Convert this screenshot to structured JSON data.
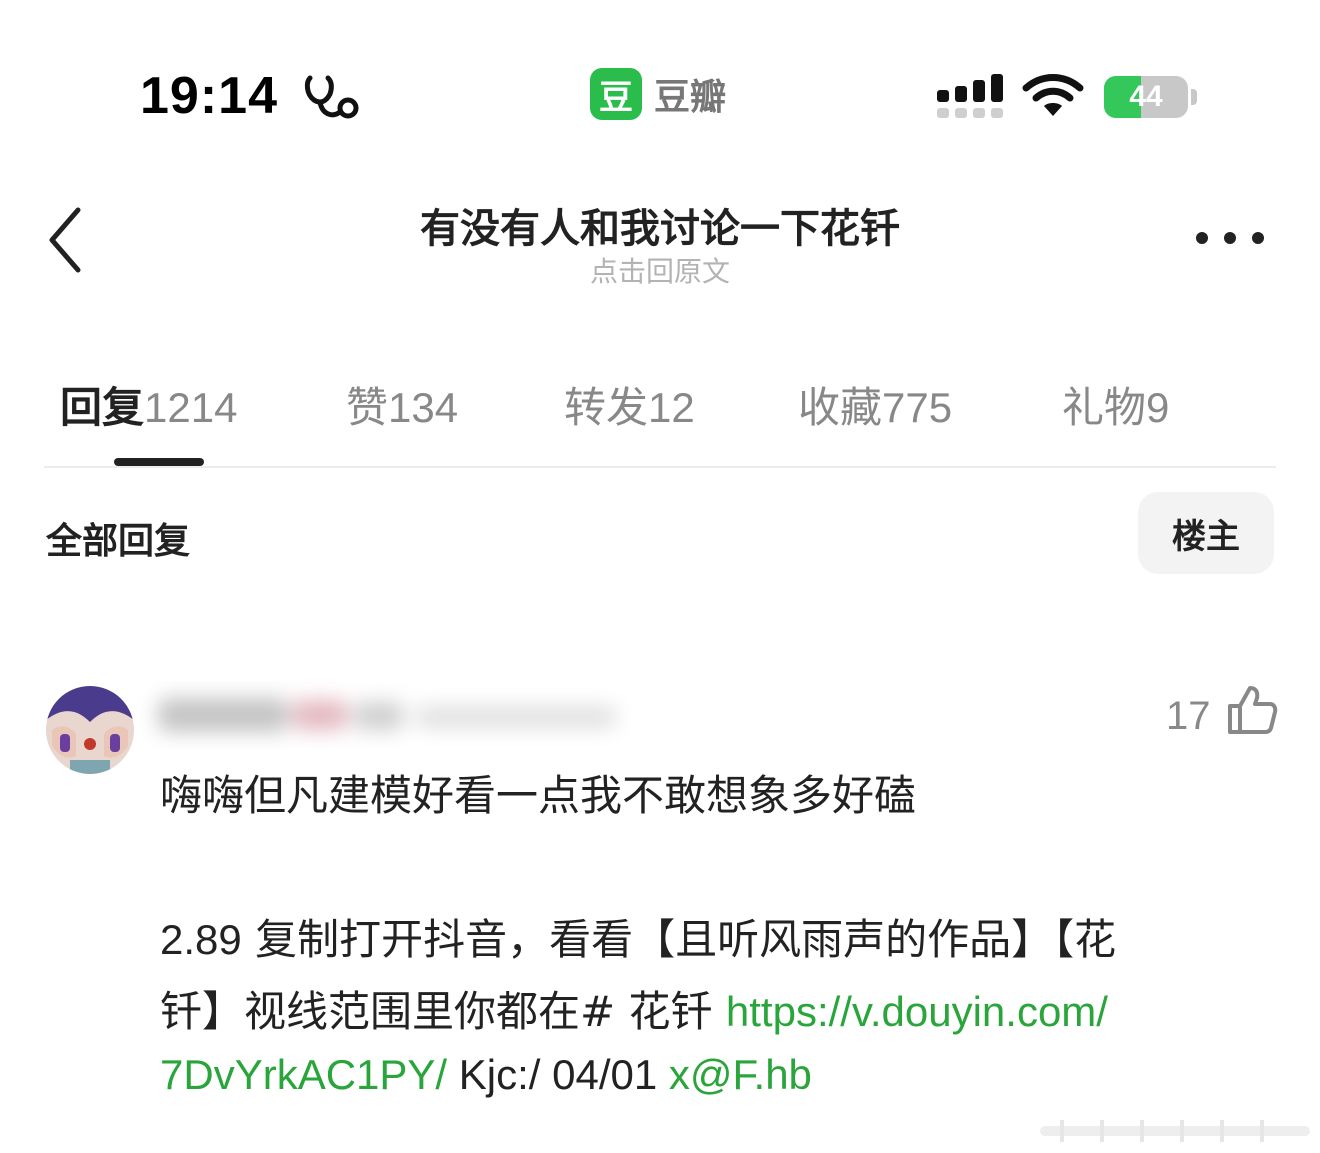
{
  "status_bar": {
    "time": "19:14",
    "app_name": "豆瓣",
    "app_logo_char": "豆",
    "battery_level": 44,
    "battery_text": "44"
  },
  "nav": {
    "title": "有没有人和我讨论一下花钎",
    "subtitle": "点击回原文"
  },
  "tabs": [
    {
      "label": "回复",
      "count": "1214",
      "active": true
    },
    {
      "label": "赞",
      "count": "134",
      "active": false
    },
    {
      "label": "转发",
      "count": "12",
      "active": false
    },
    {
      "label": "收藏",
      "count": "775",
      "active": false
    },
    {
      "label": "礼物",
      "count": "9",
      "active": false
    }
  ],
  "filter": {
    "label": "全部回复",
    "op_button": "楼主"
  },
  "comment": {
    "likes": "17",
    "line1": "嗨嗨但凡建模好看一点我不敢想象多好磕",
    "line2_num": "2.89",
    "line2_text": " 复制打开抖音，看看【且听风雨声的作品】【花",
    "line3_text": "钎】视线范围里你都在# 花钎  ",
    "link1_part1": "https://v.douyin.com/",
    "link1_part2": "7DvYrkAC1PY/",
    "line4_mid": " Kjc:/ 04/01 ",
    "link2": "x@F.hb"
  },
  "colors": {
    "brand_green": "#2bbd4b",
    "link_green": "#2aa53b",
    "battery_green": "#34c759"
  },
  "icons": [
    "stethoscope-icon",
    "signal-icon",
    "wifi-icon",
    "battery-icon",
    "back-chevron-icon",
    "more-dots-icon",
    "thumb-up-icon"
  ]
}
